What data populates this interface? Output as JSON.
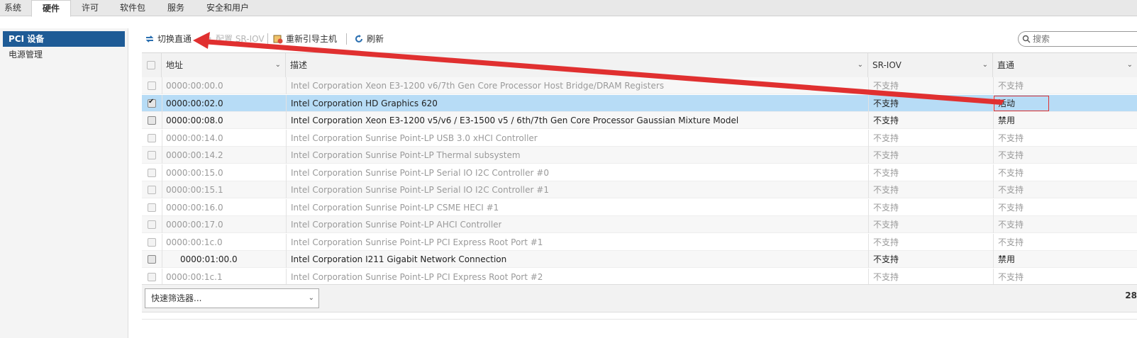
{
  "tabs": [
    "系统",
    "硬件",
    "许可",
    "软件包",
    "服务",
    "安全和用户"
  ],
  "sidebar": {
    "items": [
      "PCI 设备",
      "电源管理"
    ]
  },
  "toolbar": {
    "toggle_passthrough": "切换直通",
    "configure_sriov": "配置 SR-IOV",
    "reboot_host": "重新引导主机",
    "refresh": "刷新"
  },
  "search": {
    "placeholder": "搜索"
  },
  "columns": {
    "address": "地址",
    "description": "描述",
    "sriov": "SR-IOV",
    "passthrough": "直通"
  },
  "rows": [
    {
      "address": "0000:00:00.0",
      "description": "Intel Corporation Xeon E3-1200 v6/7th Gen Core Processor Host Bridge/DRAM Registers",
      "sriov": "不支持",
      "passthrough": "不支持"
    },
    {
      "address": "0000:00:02.0",
      "description": "Intel Corporation HD Graphics 620",
      "sriov": "不支持",
      "passthrough": "活动"
    },
    {
      "address": "0000:00:08.0",
      "description": "Intel Corporation Xeon E3-1200 v5/v6 / E3-1500 v5 / 6th/7th Gen Core Processor Gaussian Mixture Model",
      "sriov": "不支持",
      "passthrough": "禁用"
    },
    {
      "address": "0000:00:14.0",
      "description": "Intel Corporation Sunrise Point-LP USB 3.0 xHCI Controller",
      "sriov": "不支持",
      "passthrough": "不支持"
    },
    {
      "address": "0000:00:14.2",
      "description": "Intel Corporation Sunrise Point-LP Thermal subsystem",
      "sriov": "不支持",
      "passthrough": "不支持"
    },
    {
      "address": "0000:00:15.0",
      "description": "Intel Corporation Sunrise Point-LP Serial IO I2C Controller #0",
      "sriov": "不支持",
      "passthrough": "不支持"
    },
    {
      "address": "0000:00:15.1",
      "description": "Intel Corporation Sunrise Point-LP Serial IO I2C Controller #1",
      "sriov": "不支持",
      "passthrough": "不支持"
    },
    {
      "address": "0000:00:16.0",
      "description": "Intel Corporation Sunrise Point-LP CSME HECI #1",
      "sriov": "不支持",
      "passthrough": "不支持"
    },
    {
      "address": "0000:00:17.0",
      "description": "Intel Corporation Sunrise Point-LP AHCI Controller",
      "sriov": "不支持",
      "passthrough": "不支持"
    },
    {
      "address": "0000:00:1c.0",
      "description": "Intel Corporation Sunrise Point-LP PCI Express Root Port #1",
      "sriov": "不支持",
      "passthrough": "不支持"
    },
    {
      "address": "0000:01:00.0",
      "description": "Intel Corporation I211 Gigabit Network Connection",
      "sriov": "不支持",
      "passthrough": "禁用"
    },
    {
      "address": "0000:00:1c.1",
      "description": "Intel Corporation Sunrise Point-LP PCI Express Root Port #2",
      "sriov": "不支持",
      "passthrough": "不支持"
    }
  ],
  "footer": {
    "quick_filter": "快速筛选器...",
    "count": "28"
  },
  "colors": {
    "selected_row": "#b7dcf6",
    "sidebar_active": "#1e5b96",
    "annotation": "#e03030"
  }
}
